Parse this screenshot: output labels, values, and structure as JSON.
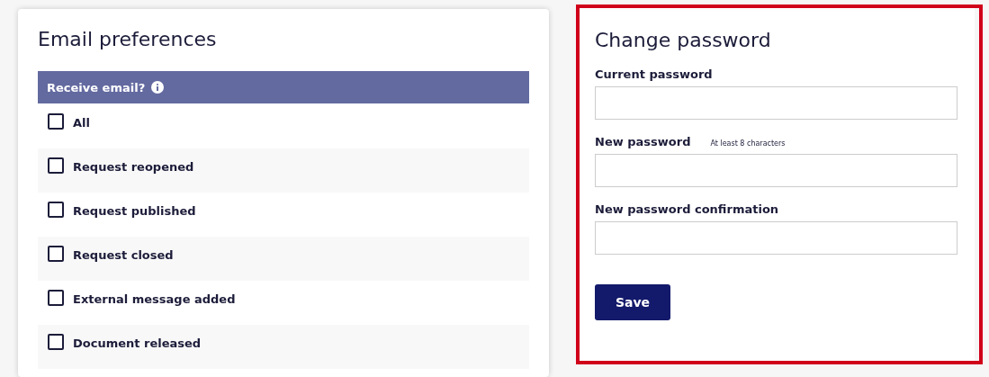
{
  "email_preferences": {
    "title": "Email preferences",
    "header": "Receive email?",
    "options": [
      {
        "label": "All",
        "checked": false
      },
      {
        "label": "Request reopened",
        "checked": false
      },
      {
        "label": "Request published",
        "checked": false
      },
      {
        "label": "Request closed",
        "checked": false
      },
      {
        "label": "External message added",
        "checked": false
      },
      {
        "label": "Document released",
        "checked": false
      }
    ]
  },
  "change_password": {
    "title": "Change password",
    "highlighted": true,
    "fields": [
      {
        "label": "Current password"
      },
      {
        "label": "New password",
        "hint": "At least 8 characters"
      },
      {
        "label": "New password confirmation"
      }
    ],
    "button": "Save"
  }
}
